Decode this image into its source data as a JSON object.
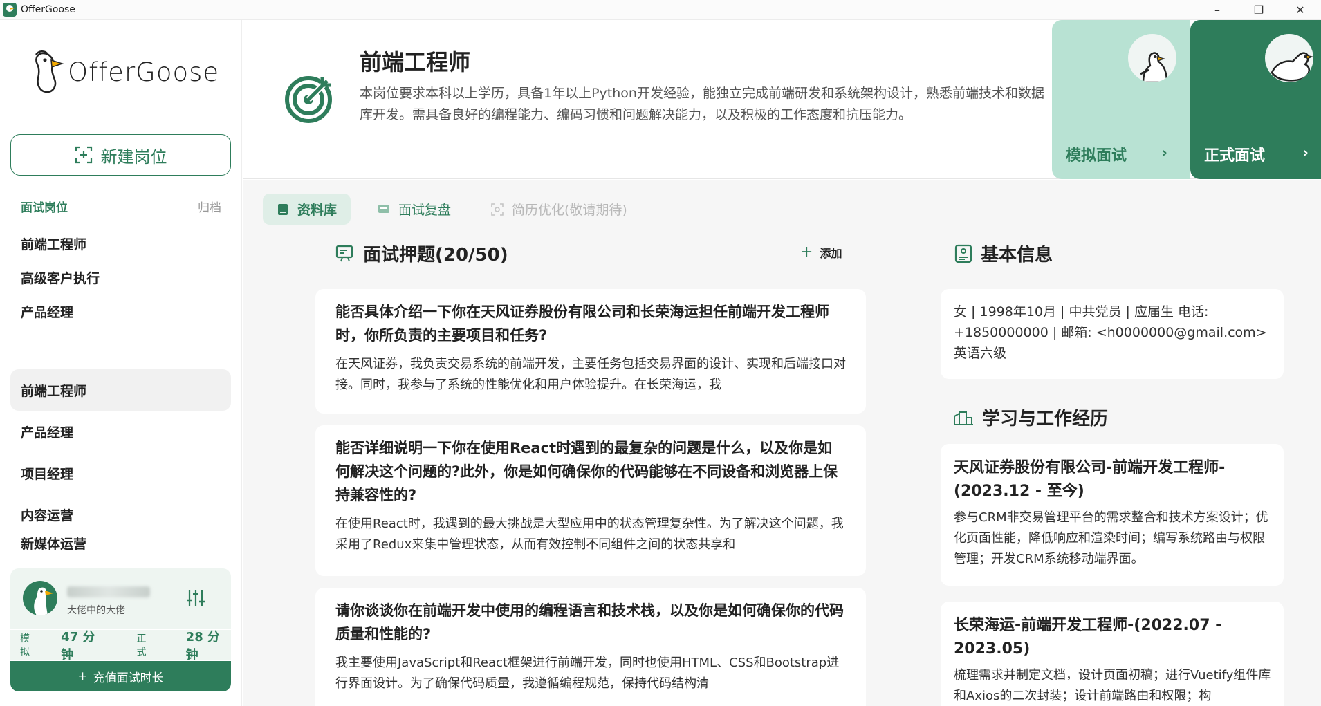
{
  "window": {
    "title": "OfferGoose",
    "min_icon": "minimize-icon",
    "restore_icon": "restore-icon",
    "close_icon": "close-icon"
  },
  "sidebar": {
    "logo_text": "OfferGoose",
    "new_job_label": "新建岗位",
    "section_label": "面试岗位",
    "archive_label": "归档",
    "items": [
      {
        "label": "前端工程师",
        "selected": false
      },
      {
        "label": "高级客户执行",
        "selected": false
      },
      {
        "label": "产品经理",
        "selected": false
      },
      {
        "label": "前端工程师",
        "selected": true
      },
      {
        "label": "产品经理",
        "selected": false
      },
      {
        "label": "项目经理",
        "selected": false
      },
      {
        "label": "内容运营",
        "selected": false
      },
      {
        "label": "新媒体运营",
        "selected": false
      }
    ],
    "user": {
      "name": "",
      "subtitle": "大佬中的大佬"
    },
    "time": {
      "mock_label": "模拟",
      "mock_value": "47 分钟",
      "formal_label": "正式",
      "formal_value": "28 分钟"
    },
    "recharge_label": "充值面试时长"
  },
  "header": {
    "title": "前端工程师",
    "description": "本岗位要求本科以上学历，具备1年以上Python开发经验，能独立完成前端研发和系统架构设计，熟悉前端技术和数据库开发。需具备良好的编程能力、编码习惯和问题解决能力，以及积极的工作态度和抗压能力。",
    "mock_label": "模拟面试",
    "formal_label": "正式面试",
    "arrow": "›"
  },
  "tabs": [
    {
      "label": "资料库",
      "state": "active"
    },
    {
      "label": "面试复盘",
      "state": "normal"
    },
    {
      "label": "简历优化(敬请期待)",
      "state": "disabled"
    }
  ],
  "questions": {
    "heading": "面试押题(20/50)",
    "add_label": "添加",
    "items": [
      {
        "q": "能否具体介绍一下你在天风证券股份有限公司和长荣海运担任前端开发工程师时，你所负责的主要项目和任务?",
        "a": "在天风证券，我负责交易系统的前端开发，主要任务包括交易界面的设计、实现和后端接口对接。同时，我参与了系统的性能优化和用户体验提升。在长荣海运，我"
      },
      {
        "q": "能否详细说明一下你在使用React时遇到的最复杂的问题是什么，以及你是如何解决这个问题的?此外，你是如何确保你的代码能够在不同设备和浏览器上保持兼容性的?",
        "a": "在使用React时，我遇到的最大挑战是大型应用中的状态管理复杂性。为了解决这个问题，我采用了Redux来集中管理状态，从而有效控制不同组件之间的状态共享和"
      },
      {
        "q": "请你谈谈你在前端开发中使用的编程语言和技术栈，以及你是如何确保你的代码质量和性能的?",
        "a": "我主要使用JavaScript和React框架进行前端开发，同时也使用HTML、CSS和Bootstrap进行界面设计。为了确保代码质量，我遵循编程规范，保持代码结构清"
      }
    ]
  },
  "basic_info": {
    "heading": "基本信息",
    "text": "女 | 1998年10月 | 中共党员 | 应届生 电话: +1850000000 | 邮箱: <h0000000@gmail.com> 英语六级"
  },
  "experience": {
    "heading": "学习与工作经历",
    "items": [
      {
        "title": "天风证券股份有限公司-前端开发工程师-(2023.12 - 至今)",
        "text": "参与CRM非交易管理平台的需求整合和技术方案设计；优化页面性能，降低响应和渲染时间；编写系统路由与权限管理；开发CRM系统移动端界面。"
      },
      {
        "title": "长荣海运-前端开发工程师-(2022.07 - 2023.05)",
        "text": "梳理需求并制定文档，设计页面初稿；进行Vuetify组件库和Axios的二次封装；设计前端路由和权限；构"
      }
    ]
  },
  "colors": {
    "brand_green": "#2e7d5b",
    "mint": "#b8e2d3",
    "tab_active_bg": "#dfeee7"
  }
}
